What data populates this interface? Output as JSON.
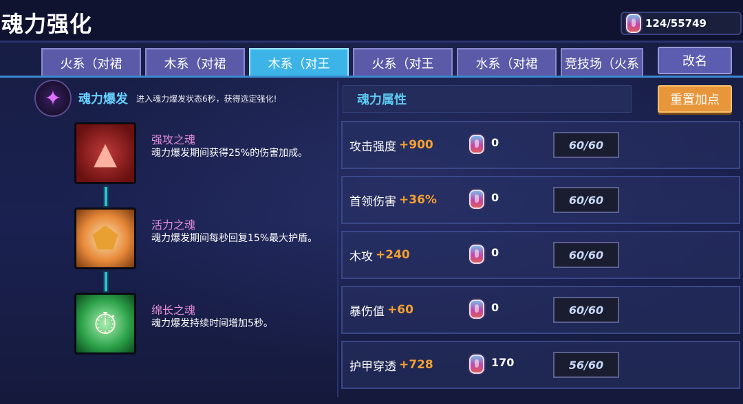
{
  "header": {
    "title": "魂力强化",
    "currency_value": "124/55749"
  },
  "tabs": [
    {
      "label": "火系（对裙"
    },
    {
      "label": "木系（对裙"
    },
    {
      "label": "木系（对王"
    },
    {
      "label": "火系（对王"
    },
    {
      "label": "水系（对裙"
    },
    {
      "label": "竞技场（火系"
    }
  ],
  "rename_label": "改名",
  "burst": {
    "title": "魂力爆发",
    "desc": "进入魂力爆发状态6秒，获得选定强化!"
  },
  "skills": [
    {
      "name": "强攻之魂",
      "desc": "魂力爆发期间获得25%的伤害加成。"
    },
    {
      "name": "活力之魂",
      "desc": "魂力爆发期间每秒回复15%最大护盾。"
    },
    {
      "name": "绵长之魂",
      "desc": "魂力爆发持续时间增加5秒。"
    }
  ],
  "attributes": {
    "header": "魂力属性",
    "reset_label": "重置加点",
    "rows": [
      {
        "name": "攻击强度",
        "bonus": "+900",
        "count": "0",
        "level": "60/60"
      },
      {
        "name": "首领伤害",
        "bonus": "+36%",
        "count": "0",
        "level": "60/60"
      },
      {
        "name": "木攻",
        "bonus": "+240",
        "count": "0",
        "level": "60/60"
      },
      {
        "name": "暴伤值",
        "bonus": "+60",
        "count": "0",
        "level": "60/60"
      },
      {
        "name": "护甲穿透",
        "bonus": "+728",
        "count": "170",
        "level": "56/60"
      }
    ]
  },
  "colors": {
    "tab_active": "#3cb4e8",
    "tab_inactive": "#5a5aa8",
    "bonus": "#f5a030",
    "skill_name": "#e58cd8",
    "accent_blue": "#5ec8f0",
    "reset_button": "#e8963a"
  },
  "icons": {
    "currency": "soul-gem-icon",
    "burst": "soul-burst-icon",
    "skills": [
      "attack-soul-icon",
      "vitality-soul-icon",
      "duration-soul-icon"
    ]
  }
}
